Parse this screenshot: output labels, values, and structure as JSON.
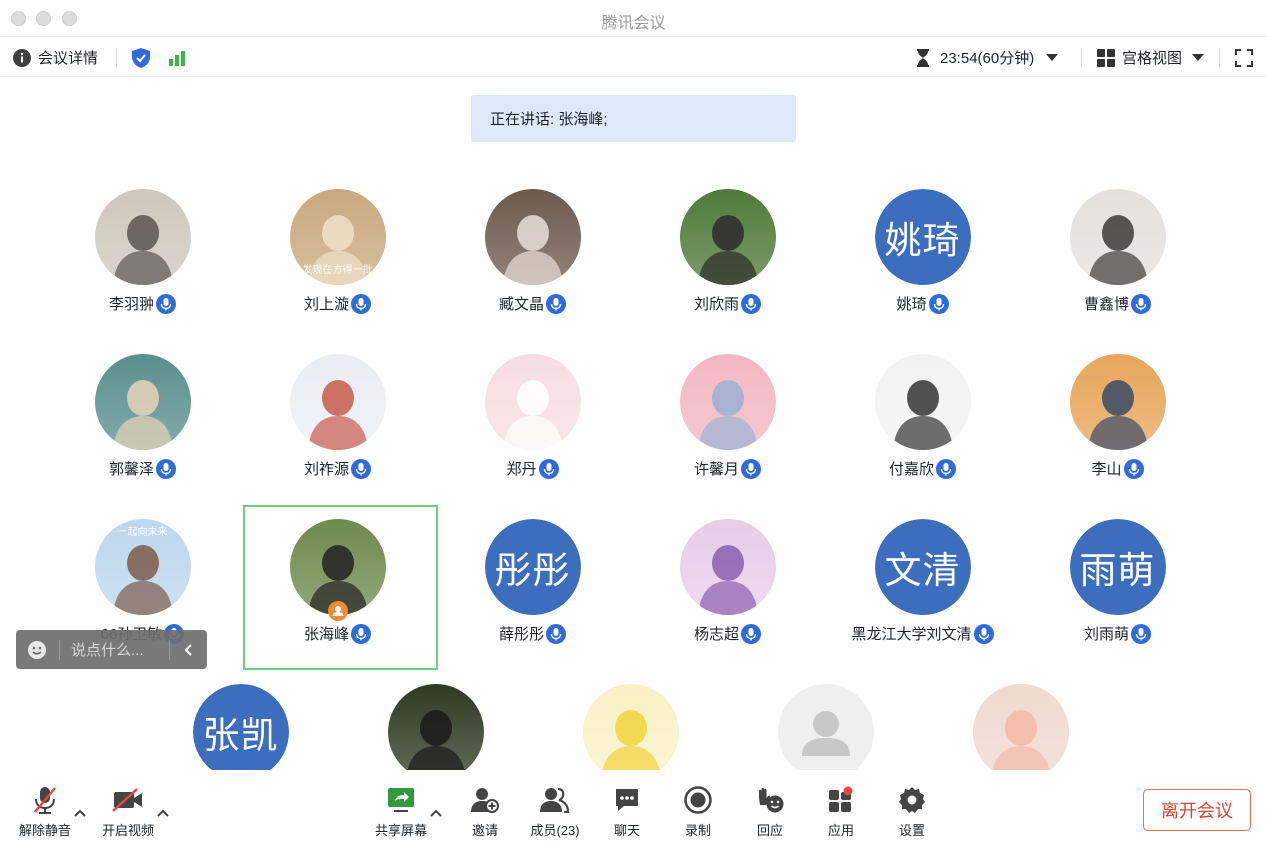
{
  "window": {
    "title": "腾讯会议"
  },
  "infobar": {
    "meeting_details": "会议详情",
    "timer": "23:54(60分钟)",
    "view_mode": "宫格视图"
  },
  "speaking_banner": "正在讲话: 张海峰;",
  "participants": [
    {
      "name": "李羽翀",
      "avatar": "photo"
    },
    {
      "name": "刘上漩",
      "avatar": "photo",
      "avatar_caption": "发现在方得一批"
    },
    {
      "name": "臧文晶",
      "avatar": "photo"
    },
    {
      "name": "刘欣雨",
      "avatar": "photo"
    },
    {
      "name": "姚琦",
      "avatar": "text",
      "avatar_text": "姚琦"
    },
    {
      "name": "曹鑫博",
      "avatar": "photo"
    },
    {
      "name": "郭馨泽",
      "avatar": "photo"
    },
    {
      "name": "刘祚源",
      "avatar": "photo"
    },
    {
      "name": "郑丹",
      "avatar": "photo"
    },
    {
      "name": "许馨月",
      "avatar": "photo"
    },
    {
      "name": "付嘉欣",
      "avatar": "photo"
    },
    {
      "name": "李山",
      "avatar": "photo"
    },
    {
      "name": "66孙卫敏",
      "avatar": "photo",
      "avatar_caption": "一起向未来"
    },
    {
      "name": "张海峰",
      "avatar": "photo",
      "host": true,
      "active": true
    },
    {
      "name": "薛彤彤",
      "avatar": "text",
      "avatar_text": "彤彤"
    },
    {
      "name": "杨志超",
      "avatar": "photo"
    },
    {
      "name": "黑龙江大学刘文清",
      "avatar": "text",
      "avatar_text": "文清"
    },
    {
      "name": "刘雨萌",
      "avatar": "text",
      "avatar_text": "雨萌"
    },
    {
      "name": "",
      "avatar": "text",
      "avatar_text": "张凯"
    },
    {
      "name": "",
      "avatar": "photo"
    },
    {
      "name": "",
      "avatar": "photo"
    },
    {
      "name": "",
      "avatar": "placeholder"
    },
    {
      "name": "",
      "avatar": "photo"
    }
  ],
  "chat": {
    "placeholder": "说点什么..."
  },
  "toolbar": {
    "unmute": "解除静音",
    "start_video": "开启视频",
    "share_screen": "共享屏幕",
    "invite": "邀请",
    "members": "成员(23)",
    "chat": "聊天",
    "record": "录制",
    "react": "回应",
    "apps": "应用",
    "settings": "设置",
    "leave": "离开会议"
  },
  "colors": {
    "accent_blue": "#3c6ebd",
    "mic_badge": "#2f6bd9",
    "signal_green": "#3fb24a",
    "active_frame": "#6ecb7f",
    "leave_red": "#d9453a",
    "host_badge": "#f08a34"
  }
}
